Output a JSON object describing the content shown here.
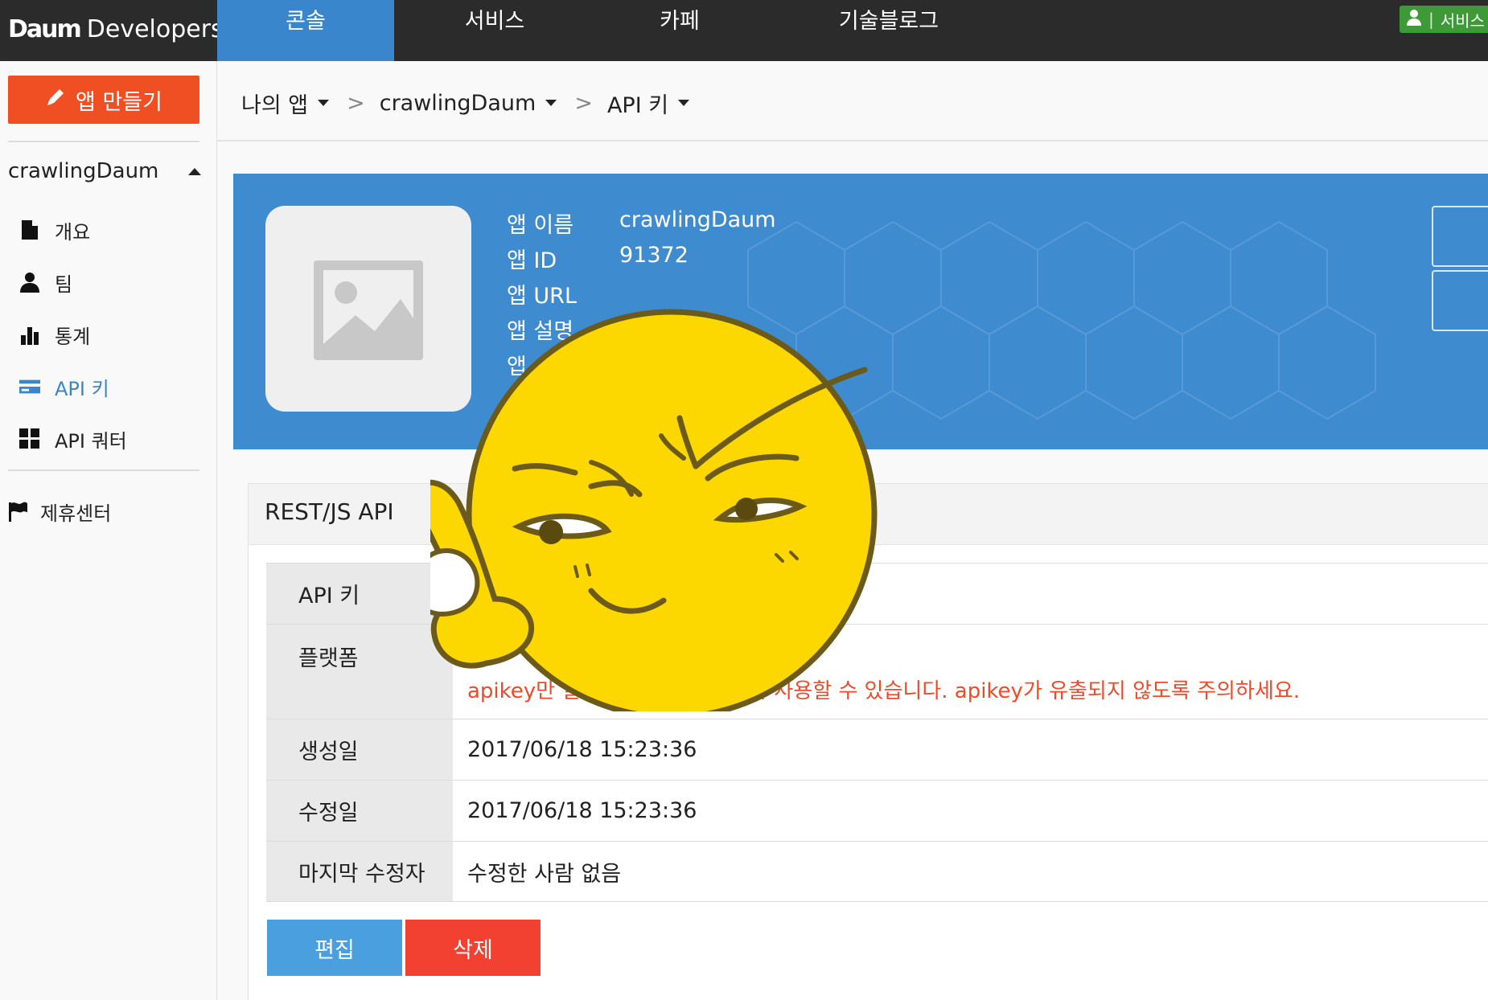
{
  "header": {
    "logo_mark": "Daum",
    "logo_text": "Developers",
    "tabs": [
      {
        "label": "콘솔",
        "active": true
      },
      {
        "label": "서비스",
        "active": false
      },
      {
        "label": "카페",
        "active": false
      },
      {
        "label": "기술블로그",
        "active": false
      }
    ],
    "service_label": "서비스"
  },
  "sidebar": {
    "create_label": "앱 만들기",
    "app_name": "crawlingDaum",
    "items": [
      {
        "label": "개요",
        "icon": "file-icon",
        "active": false
      },
      {
        "label": "팀",
        "icon": "user-icon",
        "active": false
      },
      {
        "label": "통계",
        "icon": "bar-chart-icon",
        "active": false
      },
      {
        "label": "API 키",
        "icon": "card-icon",
        "active": true
      },
      {
        "label": "API 쿼터",
        "icon": "grid-icon",
        "active": false
      }
    ],
    "partner_label": "제휴센터"
  },
  "breadcrumb": [
    "나의 앱",
    "crawlingDaum",
    "API 키"
  ],
  "app_info": {
    "rows": [
      {
        "key": "앱 이름",
        "value": "crawlingDaum"
      },
      {
        "key": "앱 ID",
        "value": "91372"
      },
      {
        "key": "앱 URL",
        "value": ""
      },
      {
        "key": "앱 설명",
        "value": ""
      },
      {
        "key": "앱",
        "value": ""
      }
    ]
  },
  "api_panel": {
    "title": "REST/JS API",
    "rows": [
      {
        "key": "API 키",
        "value": ""
      },
      {
        "key": "플랫폼",
        "value": "apikey만 알면 아무 시스템에서나 사용할 수 있습니다. apikey가 유출되지 않도록 주의하세요."
      },
      {
        "key": "생성일",
        "value": "2017/06/18 15:23:36"
      },
      {
        "key": "수정일",
        "value": "2017/06/18 15:23:36"
      },
      {
        "key": "마지막 수정자",
        "value": "수정한 사람 없음"
      }
    ],
    "edit_label": "편집",
    "delete_label": "삭제"
  },
  "colors": {
    "accent": "#3a86cc",
    "create": "#f04e23",
    "delete": "#f34131",
    "edit": "#4a9fdf",
    "warn": "#ef4a2a"
  }
}
